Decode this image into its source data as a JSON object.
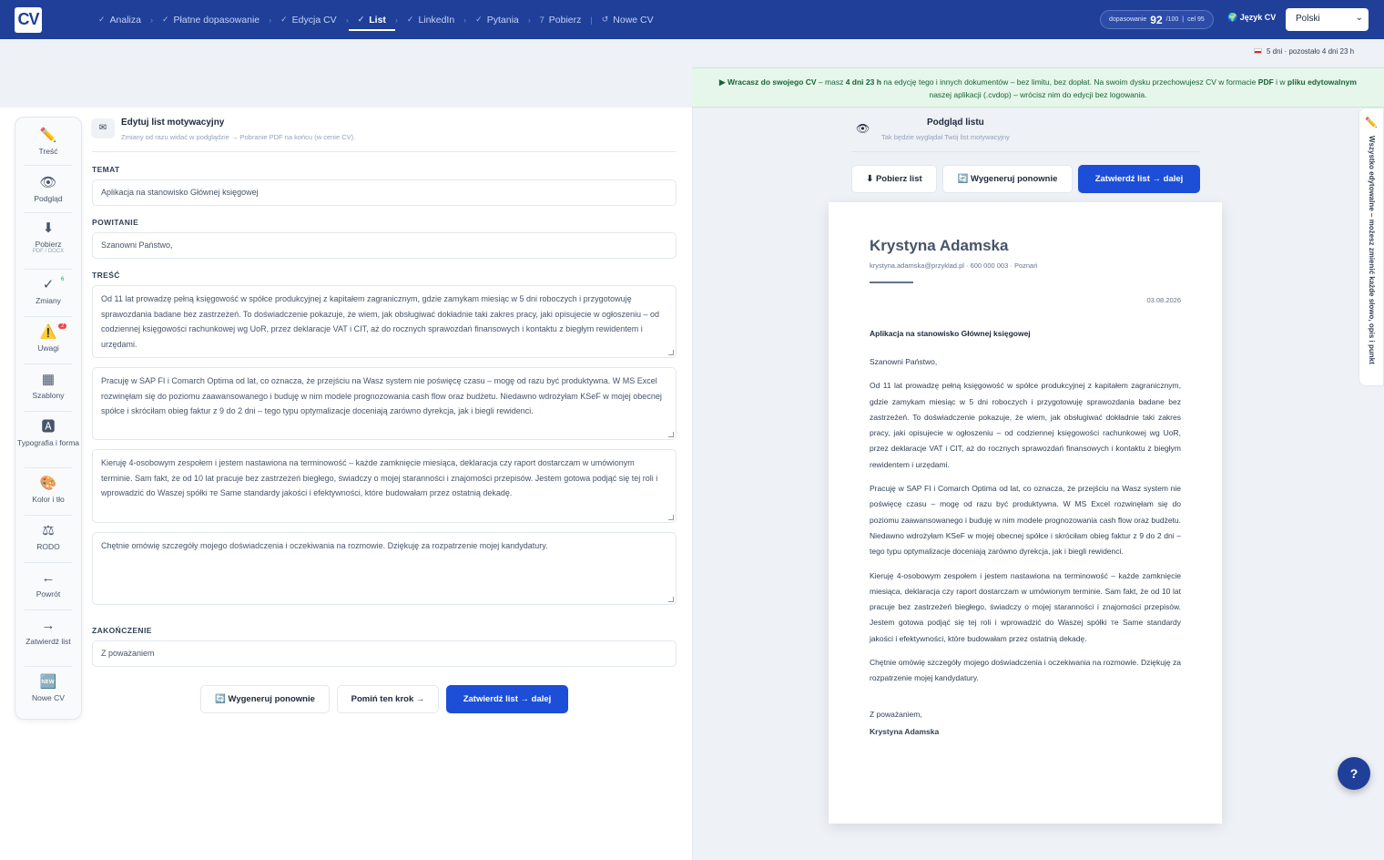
{
  "brand": {
    "logo": "CV"
  },
  "steps": [
    {
      "label": "Analiza",
      "done": true
    },
    {
      "label": "Płatne dopasowanie",
      "done": true
    },
    {
      "label": "Edycja CV",
      "done": true
    },
    {
      "label": "List",
      "done": true,
      "active": true
    },
    {
      "label": "LinkedIn",
      "done": true
    },
    {
      "label": "Pytania",
      "done": true
    },
    {
      "label": "Pobierz",
      "prefix": "7"
    },
    {
      "label": "Nowe CV",
      "prefix": "↺"
    }
  ],
  "score": {
    "label": "dopasowanie",
    "value": "92",
    "max": "/100",
    "goal": "cel 95"
  },
  "language": {
    "label": "Język CV",
    "selected": "Polski"
  },
  "timer": "5 dni · pozostało 4 dni 23 h",
  "notice": {
    "text_a": "▶ Wracasz do swojego CV",
    "text_b": " – masz ",
    "text_c": "4 dni 23 h",
    "text_d": " na edycję tego i innych dokumentów – bez limitu, bez dopłat. Na swoim dysku przechowujesz CV w formacie ",
    "text_e": "PDF",
    "text_f": " i w ",
    "text_g": "pliku edytowalnym",
    "text_h": " naszej aplikacji (.cvdop) – wrócisz nim do edycji bez logowania."
  },
  "rail": [
    {
      "label": "Treść",
      "icon": "✏️"
    },
    {
      "label": "Podgląd",
      "icon": "👁"
    },
    {
      "label": "Pobierz",
      "sub": "PDF / DOCX",
      "icon": "⬇"
    },
    {
      "label": "Zmiany",
      "icon": "✓",
      "badge": "6"
    },
    {
      "label": "Uwagi",
      "icon": "⚠️",
      "badge": "2"
    },
    {
      "label": "Szablony",
      "icon": "▦"
    },
    {
      "label": "Typografia i forma",
      "icon": "🅰"
    },
    {
      "label": "Kolor i tło",
      "icon": "🎨"
    },
    {
      "label": "RODO",
      "icon": "⚖"
    },
    {
      "label": "Powrót",
      "icon": "←"
    },
    {
      "label": "Zatwierdź list",
      "icon": "→"
    },
    {
      "label": "Nowe CV",
      "icon": "🆕"
    }
  ],
  "editor": {
    "title": "Edytuj list motywacyjny",
    "subtitle": "Zmiany od razu widać w podglądzie → Pobranie PDF na końcu (w cenie CV).",
    "subject_label": "TEMAT",
    "subject": "Aplikacja na stanowisko Głównej księgowej",
    "greeting_label": "POWITANIE",
    "greeting": "Szanowni Państwo,",
    "body_label": "TREŚĆ",
    "paragraphs": [
      "Od 11 lat prowadzę pełną księgowość w spółce produkcyjnej z kapitałem zagranicznym, gdzie zamykam miesiąc w 5 dni roboczych i przygotowuję sprawozdania badane bez zastrzeżeń. To doświadczenie pokazuje, że wiem, jak obsługiwać dokładnie taki zakres pracy, jaki opisujecie w ogłoszeniu – od codziennej księgowości rachunkowej wg UoR, przez deklaracje VAT i CIT, aż do rocznych sprawozdań finansowych i kontaktu z biegłym rewidentem i urzędami.",
      "Pracuję w SAP FI i Comarch Optima od lat, co oznacza, że przejściu na Wasz system nie poświęcę czasu – mogę od razu być produktywna. W MS Excel rozwinęłam się do poziomu zaawansowanego i buduję w nim modele prognozowania cash flow oraz budżetu. Niedawno wdrożyłam KSeF w mojej obecnej spółce i skróciłam obieg faktur z 9 do 2 dni – tego typu optymalizacje doceniają zarówno dyrekcja, jak i biegli rewidenci.",
      "Kieruję 4-osobowym zespołem i jestem nastawiona na terminowość – każde zamknięcie miesiąca, deklaracja czy raport dostarczam w umówionym terminie. Sam fakt, że od 10 lat pracuje bez zastrzeżeń biegłego, świadczy o mojej staranności i znajomości przepisów. Jestem gotowa podjąć się tej roli i wprowadzić do Waszej spółki те Same standardy jakości i efektywności, które budowałam przez ostatnią dekadę.",
      "Chętnie omówię szczegóły mojego doświadczenia i oczekiwania na rozmowie. Dziękuję za rozpatrzenie mojej kandydatury."
    ],
    "closing_label": "ZAKOŃCZENIE",
    "closing": "Z poważaniem",
    "btn_regen": "🔄 Wygeneruj ponownie",
    "btn_skip": "Pomiń ten krok →",
    "btn_confirm": "Zatwierdź list → dalej"
  },
  "preview": {
    "title": "Podgląd listu",
    "subtitle": "Tak będzie wyglądał Twój list motywacyjny",
    "btn_download": "⬇ Pobierz list",
    "btn_regen": "🔄 Wygeneruj ponownie",
    "btn_confirm": "Zatwierdź list → dalej",
    "name": "Krystyna Adamska",
    "contact": "krystyna.adamska@przyklad.pl · 600 000 003 · Poznań",
    "date": "03.08.2026",
    "subject": "Aplikacja na stanowisko Głównej księgowej",
    "greeting": "Szanowni Państwo,",
    "closing": "Z poważaniem,",
    "signature": "Krystyna Adamska"
  },
  "sidetab": "Wszystko edytowalne – możesz zmienić każde słowo, opis i punkt",
  "help": "?"
}
